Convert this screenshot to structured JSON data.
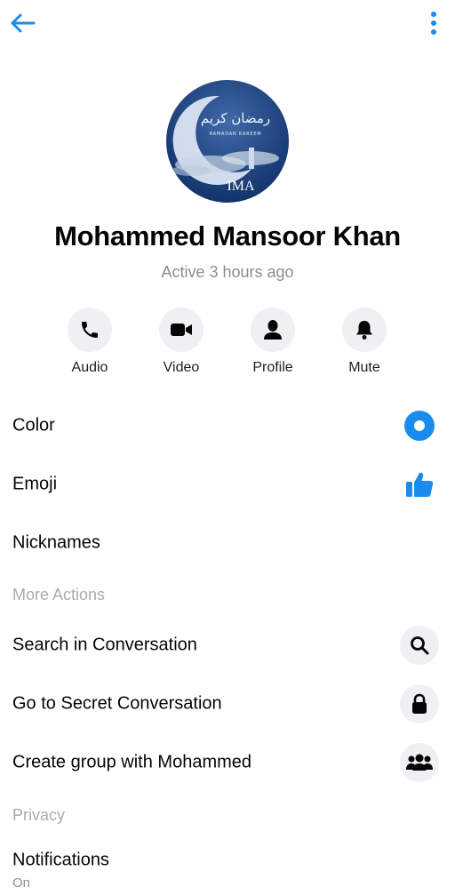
{
  "profile": {
    "name": "Mohammed Mansoor Khan",
    "status": "Active 3 hours ago",
    "avatar": {
      "script_text": "رمضان كريم",
      "caption": "RAMADAN KAREEM",
      "brand": "IMA"
    }
  },
  "actions": [
    {
      "label": "Audio",
      "icon": "phone-icon"
    },
    {
      "label": "Video",
      "icon": "video-camera-icon"
    },
    {
      "label": "Profile",
      "icon": "person-icon"
    },
    {
      "label": "Mute",
      "icon": "bell-icon"
    }
  ],
  "customize": [
    {
      "label": "Color",
      "icon": "color-circle-icon"
    },
    {
      "label": "Emoji",
      "icon": "thumbs-up-icon"
    },
    {
      "label": "Nicknames"
    }
  ],
  "more_actions": {
    "heading": "More Actions",
    "items": [
      {
        "label": "Search in Conversation",
        "icon": "search-icon"
      },
      {
        "label": "Go to Secret Conversation",
        "icon": "lock-icon"
      },
      {
        "label": "Create group with Mohammed",
        "icon": "group-icon"
      }
    ]
  },
  "privacy": {
    "heading": "Privacy",
    "notifications": {
      "label": "Notifications",
      "value": "On"
    }
  },
  "colors": {
    "accent": "#1a8cf0",
    "icon_bg": "#eef0f3",
    "muted_text": "#8a8d91"
  }
}
